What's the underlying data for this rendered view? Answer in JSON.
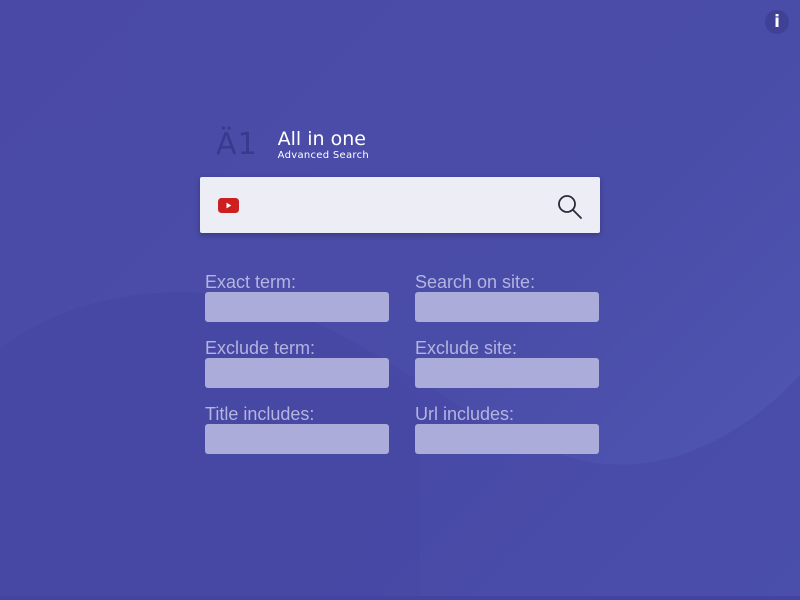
{
  "logo": {
    "mark": "Ä1",
    "title": "All in one",
    "subtitle": "Advanced Search"
  },
  "info_button": {
    "label": "i"
  },
  "search": {
    "engine_icon": "youtube-icon",
    "placeholder": "",
    "value": "",
    "button_icon": "search-icon"
  },
  "fields": {
    "exact_term": {
      "label": "Exact term:",
      "value": ""
    },
    "search_on_site": {
      "label": "Search on site:",
      "value": ""
    },
    "exclude_term": {
      "label": "Exclude term:",
      "value": ""
    },
    "exclude_site": {
      "label": "Exclude site:",
      "value": ""
    },
    "title_includes": {
      "label": "Title includes:",
      "value": ""
    },
    "url_includes": {
      "label": "Url includes:",
      "value": ""
    }
  },
  "colors": {
    "background": "#4a4aa6",
    "search_bar": "#ededf5",
    "field_background": "#acacda",
    "label": "#b3b4e0",
    "youtube_red": "#cc2020"
  }
}
